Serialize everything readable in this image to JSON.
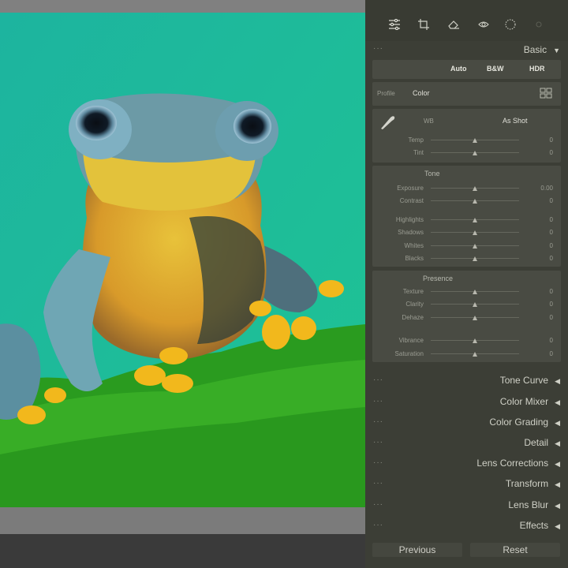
{
  "panel": {
    "tools": [
      {
        "icon": "sliders-icon"
      },
      {
        "icon": "crop-icon"
      },
      {
        "icon": "eraser-icon"
      },
      {
        "icon": "redeye-icon"
      },
      {
        "icon": "masking-icon"
      },
      {
        "icon": "presets-icon"
      }
    ],
    "basic": {
      "title": "Basic",
      "auto": "Auto",
      "bw": "B&W",
      "hdr": "HDR",
      "profile_label": "Profile",
      "profile_value": "Color",
      "wb_label": "WB",
      "wb_value": "As Shot",
      "temp": {
        "label": "Temp",
        "value": "0",
        "level": 0.5
      },
      "tint": {
        "label": "Tint",
        "value": "0",
        "level": 0.5
      },
      "tone_title": "Tone",
      "exposure": {
        "label": "Exposure",
        "value": "0.00",
        "level": 0.5
      },
      "contrast": {
        "label": "Contrast",
        "value": "0",
        "level": 0.5
      },
      "highlights": {
        "label": "Highlights",
        "value": "0",
        "level": 0.5
      },
      "shadows": {
        "label": "Shadows",
        "value": "0",
        "level": 0.5
      },
      "whites": {
        "label": "Whites",
        "value": "0",
        "level": 0.5
      },
      "blacks": {
        "label": "Blacks",
        "value": "0",
        "level": 0.5
      },
      "presence_title": "Presence",
      "texture": {
        "label": "Texture",
        "value": "0",
        "level": 0.5
      },
      "clarity": {
        "label": "Clarity",
        "value": "0",
        "level": 0.5
      },
      "dehaze": {
        "label": "Dehaze",
        "value": "0",
        "level": 0.5
      },
      "vibrance": {
        "label": "Vibrance",
        "value": "0",
        "level": 0.5
      },
      "saturation": {
        "label": "Saturation",
        "value": "0",
        "level": 0.5
      }
    },
    "sections": [
      "Tone Curve",
      "Color Mixer",
      "Color Grading",
      "Detail",
      "Lens Corrections",
      "Transform",
      "Lens Blur",
      "Effects"
    ],
    "previous": "Previous",
    "reset": "Reset"
  },
  "colors": {
    "panel_bg": "#3c3e36",
    "photo_bg": "#1fb69c",
    "moss": "#2e9d1f"
  }
}
